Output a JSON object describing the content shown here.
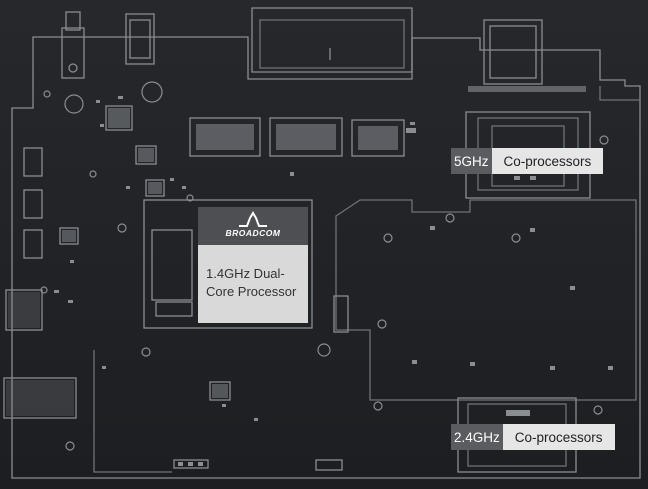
{
  "brand": "BROADCOM",
  "processor_label": "1.4GHz Dual-\nCore Processor",
  "coprocessors": [
    {
      "freq": "5GHz",
      "label": "Co-processors"
    },
    {
      "freq": "2.4GHz",
      "label": "Co-processors"
    }
  ],
  "colors": {
    "background": "#1f2124",
    "trace": "#8e9196",
    "label_dark": "#5a5c60",
    "label_light": "#e6e6e6"
  }
}
